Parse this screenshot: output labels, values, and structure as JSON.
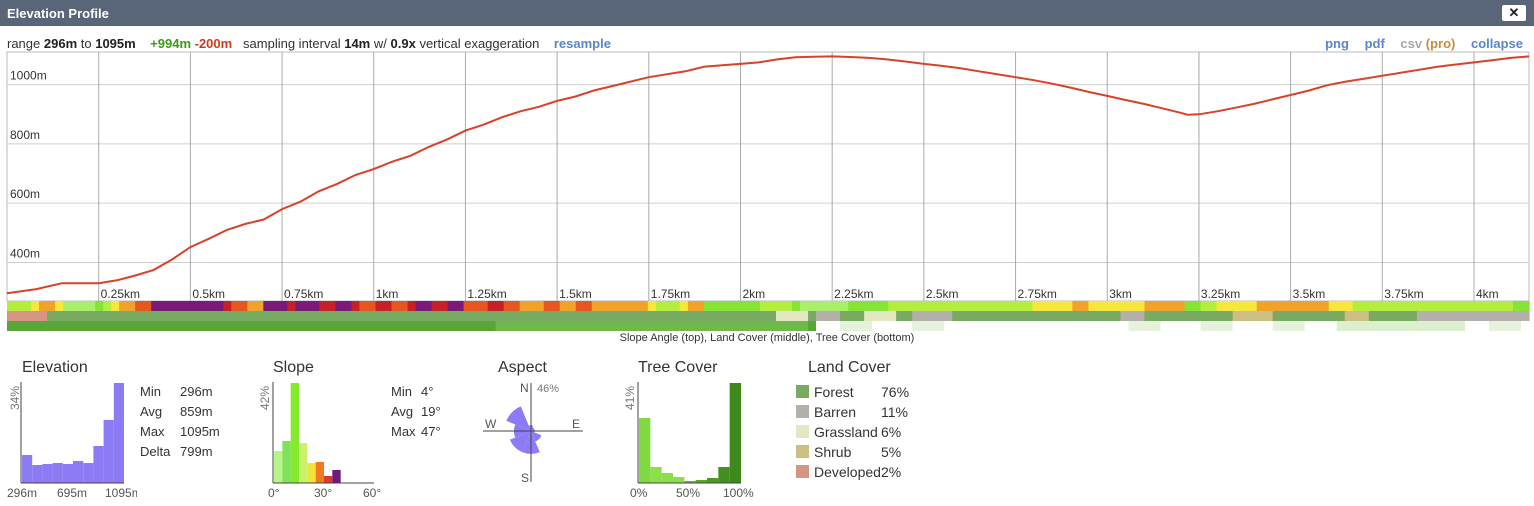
{
  "window": {
    "title": "Elevation Profile",
    "close_label": "✕"
  },
  "summary": {
    "range_prefix": "range",
    "range_min": "296m",
    "range_to": "to",
    "range_max": "1095m",
    "gain": "+994m",
    "loss": "-200m",
    "sampling_prefix": "sampling interval",
    "sampling_value": "14m",
    "w_label": "w/",
    "exaggeration_value": "0.9x",
    "exaggeration_suffix": "vertical exaggeration",
    "resample_label": "resample"
  },
  "toolbar": {
    "png": "png",
    "pdf": "pdf",
    "csv": "csv",
    "pro": "(pro)",
    "collapse": "collapse"
  },
  "colors": {
    "profile_line": "#d94128",
    "grid": "#cfcfcf",
    "histogram": "#8b7cf6",
    "forest": "#78aa62",
    "barren": "#b2b0a8",
    "grassland": "#e3e8c2",
    "shrub": "#cdbf83",
    "developed": "#d59583"
  },
  "profile": {
    "y_ticks": [
      {
        "value": 400,
        "label": "400m"
      },
      {
        "value": 600,
        "label": "600m"
      },
      {
        "value": 800,
        "label": "800m"
      },
      {
        "value": 1000,
        "label": "1000m"
      }
    ],
    "y_range": [
      270,
      1110
    ],
    "x_range": [
      0,
      4.15
    ],
    "x_ticks": [
      {
        "value": 0.25,
        "label": "0.25km"
      },
      {
        "value": 0.5,
        "label": "0.5km"
      },
      {
        "value": 0.75,
        "label": "0.75km"
      },
      {
        "value": 1.0,
        "label": "1km"
      },
      {
        "value": 1.25,
        "label": "1.25km"
      },
      {
        "value": 1.5,
        "label": "1.5km"
      },
      {
        "value": 1.75,
        "label": "1.75km"
      },
      {
        "value": 2.0,
        "label": "2km"
      },
      {
        "value": 2.25,
        "label": "2.25km"
      },
      {
        "value": 2.5,
        "label": "2.5km"
      },
      {
        "value": 2.75,
        "label": "2.75km"
      },
      {
        "value": 3.0,
        "label": "3km"
      },
      {
        "value": 3.25,
        "label": "3.25km"
      },
      {
        "value": 3.5,
        "label": "3.5km"
      },
      {
        "value": 3.75,
        "label": "3.75km"
      },
      {
        "value": 4.0,
        "label": "4km"
      }
    ],
    "points": [
      [
        0,
        296
      ],
      [
        0.08,
        310
      ],
      [
        0.15,
        330
      ],
      [
        0.2,
        330
      ],
      [
        0.25,
        330
      ],
      [
        0.3,
        340
      ],
      [
        0.35,
        356
      ],
      [
        0.4,
        375
      ],
      [
        0.45,
        410
      ],
      [
        0.5,
        452
      ],
      [
        0.55,
        480
      ],
      [
        0.6,
        510
      ],
      [
        0.65,
        530
      ],
      [
        0.7,
        545
      ],
      [
        0.75,
        580
      ],
      [
        0.8,
        605
      ],
      [
        0.85,
        640
      ],
      [
        0.9,
        665
      ],
      [
        0.95,
        695
      ],
      [
        1.0,
        715
      ],
      [
        1.05,
        740
      ],
      [
        1.1,
        760
      ],
      [
        1.15,
        790
      ],
      [
        1.2,
        815
      ],
      [
        1.25,
        845
      ],
      [
        1.3,
        865
      ],
      [
        1.35,
        890
      ],
      [
        1.4,
        910
      ],
      [
        1.45,
        925
      ],
      [
        1.5,
        945
      ],
      [
        1.55,
        960
      ],
      [
        1.6,
        980
      ],
      [
        1.65,
        995
      ],
      [
        1.7,
        1010
      ],
      [
        1.75,
        1025
      ],
      [
        1.8,
        1035
      ],
      [
        1.85,
        1045
      ],
      [
        1.9,
        1060
      ],
      [
        1.95,
        1065
      ],
      [
        2.0,
        1070
      ],
      [
        2.05,
        1075
      ],
      [
        2.1,
        1085
      ],
      [
        2.15,
        1092
      ],
      [
        2.2,
        1094
      ],
      [
        2.25,
        1095
      ],
      [
        2.3,
        1093
      ],
      [
        2.35,
        1090
      ],
      [
        2.4,
        1085
      ],
      [
        2.45,
        1078
      ],
      [
        2.5,
        1070
      ],
      [
        2.55,
        1063
      ],
      [
        2.6,
        1055
      ],
      [
        2.65,
        1045
      ],
      [
        2.7,
        1035
      ],
      [
        2.75,
        1025
      ],
      [
        2.8,
        1015
      ],
      [
        2.85,
        1003
      ],
      [
        2.9,
        990
      ],
      [
        2.95,
        975
      ],
      [
        3.0,
        962
      ],
      [
        3.05,
        948
      ],
      [
        3.1,
        935
      ],
      [
        3.15,
        920
      ],
      [
        3.2,
        905
      ],
      [
        3.22,
        898
      ],
      [
        3.25,
        900
      ],
      [
        3.3,
        910
      ],
      [
        3.35,
        922
      ],
      [
        3.4,
        935
      ],
      [
        3.45,
        950
      ],
      [
        3.5,
        965
      ],
      [
        3.55,
        980
      ],
      [
        3.6,
        998
      ],
      [
        3.65,
        1010
      ],
      [
        3.7,
        1020
      ],
      [
        3.75,
        1030
      ],
      [
        3.8,
        1040
      ],
      [
        3.85,
        1050
      ],
      [
        3.9,
        1060
      ],
      [
        3.95,
        1068
      ],
      [
        4.0,
        1075
      ],
      [
        4.05,
        1082
      ],
      [
        4.1,
        1090
      ],
      [
        4.15,
        1095
      ]
    ]
  },
  "strips": {
    "caption": "Slope Angle (top), Land Cover (middle), Tree Cover (bottom)"
  },
  "elevation_panel": {
    "title": "Elevation",
    "y_max_label": "34%",
    "x_labels": [
      "296m",
      "695m",
      "1095m"
    ],
    "histogram": [
      0.28,
      0.18,
      0.19,
      0.2,
      0.19,
      0.22,
      0.2,
      0.37,
      0.63,
      1.0
    ],
    "stats": [
      {
        "key": "Min",
        "value": "296m"
      },
      {
        "key": "Avg",
        "value": "859m"
      },
      {
        "key": "Max",
        "value": "1095m"
      },
      {
        "key": "Delta",
        "value": "799m"
      }
    ]
  },
  "slope_panel": {
    "title": "Slope",
    "y_max_label": "42%",
    "x_labels": [
      "0°",
      "30°",
      "60°"
    ],
    "histogram": [
      {
        "value": 0.32,
        "color": "#b7f58a"
      },
      {
        "value": 0.42,
        "color": "#7fe25a"
      },
      {
        "value": 1.0,
        "color": "#85ea2c"
      },
      {
        "value": 0.4,
        "color": "#c9f26a"
      },
      {
        "value": 0.2,
        "color": "#f2e33b"
      },
      {
        "value": 0.21,
        "color": "#ef7a22"
      },
      {
        "value": 0.07,
        "color": "#d93a2b"
      },
      {
        "value": 0.13,
        "color": "#6f1a7c"
      }
    ],
    "stats": [
      {
        "key": "Min",
        "value": "4°"
      },
      {
        "key": "Avg",
        "value": "19°"
      },
      {
        "key": "Max",
        "value": "47°"
      }
    ]
  },
  "aspect_panel": {
    "title": "Aspect",
    "n_label": "N",
    "n_pct": "46%",
    "e_label": "E",
    "w_label": "W",
    "s_label": "S",
    "sectors": [
      0.15,
      0.1,
      0.1,
      0.3,
      0.6,
      0.6,
      0.45,
      0.7
    ]
  },
  "tree_panel": {
    "title": "Tree Cover",
    "y_max_label": "41%",
    "x_labels": [
      "0%",
      "50%",
      "100%"
    ],
    "histogram": [
      {
        "value": 0.65,
        "color": "#7fd941"
      },
      {
        "value": 0.16,
        "color": "#8be04a"
      },
      {
        "value": 0.1,
        "color": "#8be04a"
      },
      {
        "value": 0.06,
        "color": "#8be04a"
      },
      {
        "value": 0.02,
        "color": "#66bb33"
      },
      {
        "value": 0.03,
        "color": "#56a82a"
      },
      {
        "value": 0.05,
        "color": "#4c9a24"
      },
      {
        "value": 0.16,
        "color": "#44901f"
      },
      {
        "value": 1.0,
        "color": "#3c8a1c"
      }
    ]
  },
  "landcover_panel": {
    "title": "Land Cover",
    "items": [
      {
        "name": "Forest",
        "pct": "76%",
        "color": "#78aa62"
      },
      {
        "name": "Barren",
        "pct": "11%",
        "color": "#b2b0a8"
      },
      {
        "name": "Grassland",
        "pct": "6%",
        "color": "#e3e8c2"
      },
      {
        "name": "Shrub",
        "pct": "5%",
        "color": "#cdbf83"
      },
      {
        "name": "Developed",
        "pct": "2%",
        "color": "#d59583"
      }
    ]
  }
}
